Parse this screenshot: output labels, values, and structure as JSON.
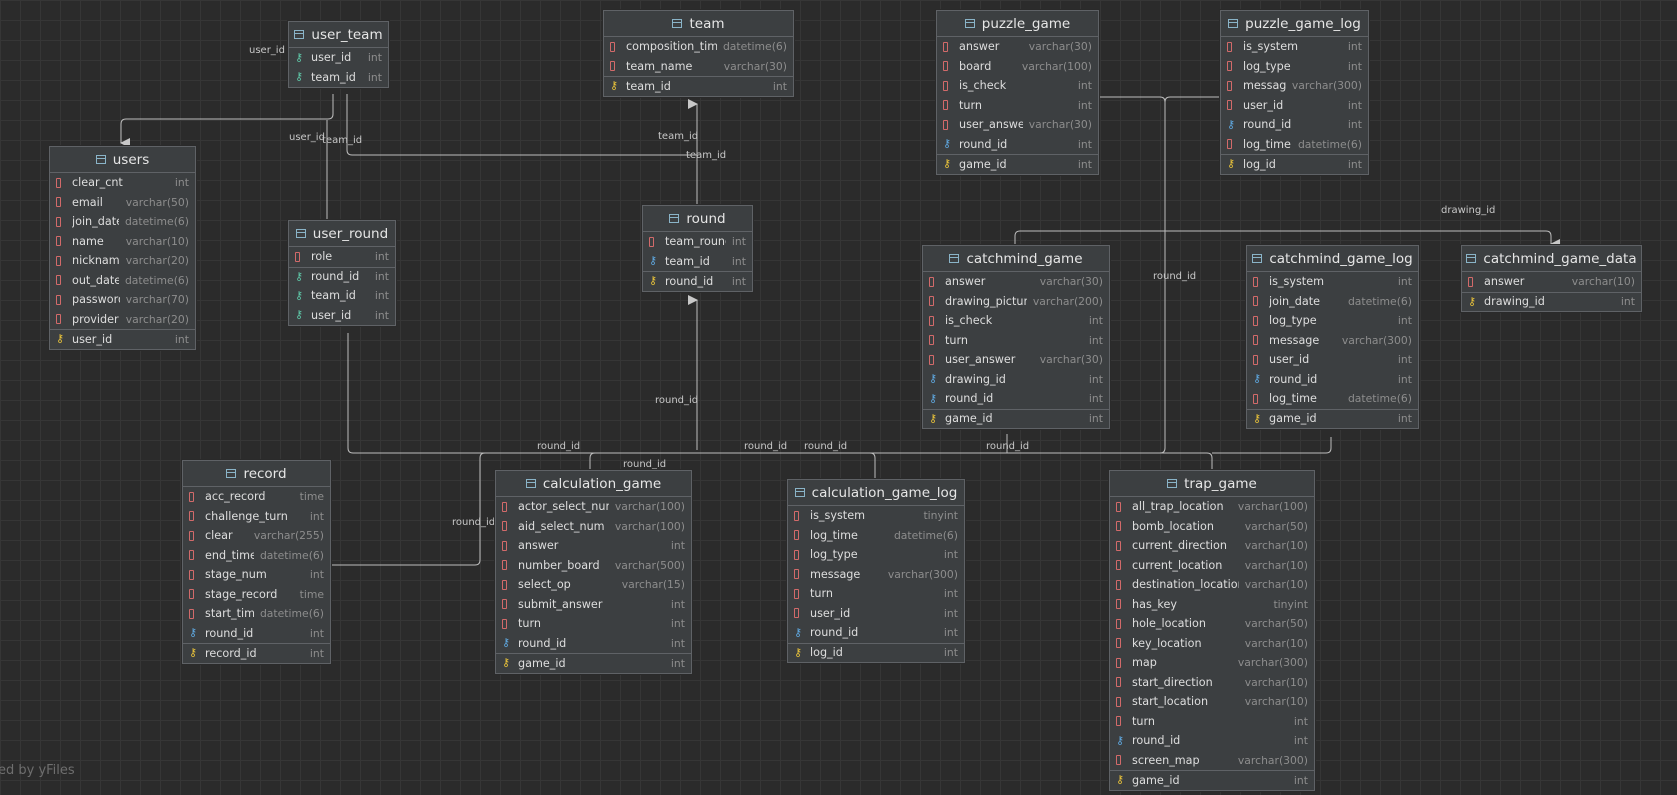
{
  "watermark": "ed by yFiles",
  "colors": {
    "background": "#2b2b2b",
    "table": "#3c3f41",
    "column_icon": "#d26a6a",
    "primary_key": "#e8c23a",
    "foreign_key": "#5fa8e0"
  },
  "tables": [
    {
      "name": "user_team",
      "columns": [
        {
          "name": "user_id",
          "type": "int",
          "icon": "pk-fk-key-icon"
        },
        {
          "name": "team_id",
          "type": "int",
          "icon": "pk-fk-key-icon"
        }
      ],
      "keys": []
    },
    {
      "name": "team",
      "columns": [
        {
          "name": "composition_time",
          "type": "datetime(6)",
          "icon": "column-icon"
        },
        {
          "name": "team_name",
          "type": "varchar(30)",
          "icon": "column-icon"
        }
      ],
      "keys": [
        {
          "name": "team_id",
          "type": "int",
          "icon": "primary-key-icon"
        }
      ]
    },
    {
      "name": "puzzle_game",
      "columns": [
        {
          "name": "answer",
          "type": "varchar(30)",
          "icon": "column-icon"
        },
        {
          "name": "board",
          "type": "varchar(100)",
          "icon": "column-icon"
        },
        {
          "name": "is_check",
          "type": "int",
          "icon": "column-icon"
        },
        {
          "name": "turn",
          "type": "int",
          "icon": "column-icon"
        },
        {
          "name": "user_answer",
          "type": "varchar(30)",
          "icon": "column-icon"
        },
        {
          "name": "round_id",
          "type": "int",
          "icon": "foreign-key-icon"
        }
      ],
      "keys": [
        {
          "name": "game_id",
          "type": "int",
          "icon": "primary-key-icon"
        }
      ]
    },
    {
      "name": "puzzle_game_log",
      "columns": [
        {
          "name": "is_system",
          "type": "int",
          "icon": "column-icon"
        },
        {
          "name": "log_type",
          "type": "int",
          "icon": "column-icon"
        },
        {
          "name": "message",
          "type": "varchar(300)",
          "icon": "column-icon"
        },
        {
          "name": "user_id",
          "type": "int",
          "icon": "column-icon"
        },
        {
          "name": "round_id",
          "type": "int",
          "icon": "foreign-key-icon"
        },
        {
          "name": "log_time",
          "type": "datetime(6)",
          "icon": "column-icon"
        }
      ],
      "keys": [
        {
          "name": "log_id",
          "type": "int",
          "icon": "primary-key-icon"
        }
      ]
    },
    {
      "name": "users",
      "columns": [
        {
          "name": "clear_cnt",
          "type": "int",
          "icon": "column-icon"
        },
        {
          "name": "email",
          "type": "varchar(50)",
          "icon": "column-icon"
        },
        {
          "name": "join_date",
          "type": "datetime(6)",
          "icon": "column-icon"
        },
        {
          "name": "name",
          "type": "varchar(10)",
          "icon": "column-icon"
        },
        {
          "name": "nickname",
          "type": "varchar(20)",
          "icon": "column-icon"
        },
        {
          "name": "out_date",
          "type": "datetime(6)",
          "icon": "column-icon"
        },
        {
          "name": "password",
          "type": "varchar(70)",
          "icon": "column-icon"
        },
        {
          "name": "provider",
          "type": "varchar(20)",
          "icon": "column-icon"
        }
      ],
      "keys": [
        {
          "name": "user_id",
          "type": "int",
          "icon": "primary-key-icon"
        }
      ]
    },
    {
      "name": "user_round",
      "columns": [
        {
          "name": "role",
          "type": "int",
          "icon": "column-icon"
        }
      ],
      "keys": [
        {
          "name": "round_id",
          "type": "int",
          "icon": "pk-fk-key-icon"
        },
        {
          "name": "team_id",
          "type": "int",
          "icon": "pk-fk-key-icon"
        },
        {
          "name": "user_id",
          "type": "int",
          "icon": "pk-fk-key-icon"
        }
      ]
    },
    {
      "name": "round",
      "columns": [
        {
          "name": "team_round",
          "type": "int",
          "icon": "column-icon"
        },
        {
          "name": "team_id",
          "type": "int",
          "icon": "foreign-key-icon"
        }
      ],
      "keys": [
        {
          "name": "round_id",
          "type": "int",
          "icon": "primary-key-icon"
        }
      ]
    },
    {
      "name": "catchmind_game",
      "columns": [
        {
          "name": "answer",
          "type": "varchar(30)",
          "icon": "column-icon"
        },
        {
          "name": "drawing_picture",
          "type": "varchar(200)",
          "icon": "column-icon"
        },
        {
          "name": "is_check",
          "type": "int",
          "icon": "column-icon"
        },
        {
          "name": "turn",
          "type": "int",
          "icon": "column-icon"
        },
        {
          "name": "user_answer",
          "type": "varchar(30)",
          "icon": "column-icon"
        },
        {
          "name": "drawing_id",
          "type": "int",
          "icon": "foreign-key-icon"
        },
        {
          "name": "round_id",
          "type": "int",
          "icon": "foreign-key-icon"
        }
      ],
      "keys": [
        {
          "name": "game_id",
          "type": "int",
          "icon": "primary-key-icon"
        }
      ]
    },
    {
      "name": "catchmind_game_log",
      "columns": [
        {
          "name": "is_system",
          "type": "int",
          "icon": "column-icon"
        },
        {
          "name": "join_date",
          "type": "datetime(6)",
          "icon": "column-icon"
        },
        {
          "name": "log_type",
          "type": "int",
          "icon": "column-icon"
        },
        {
          "name": "message",
          "type": "varchar(300)",
          "icon": "column-icon"
        },
        {
          "name": "user_id",
          "type": "int",
          "icon": "column-icon"
        },
        {
          "name": "round_id",
          "type": "int",
          "icon": "foreign-key-icon"
        },
        {
          "name": "log_time",
          "type": "datetime(6)",
          "icon": "column-icon"
        }
      ],
      "keys": [
        {
          "name": "game_id",
          "type": "int",
          "icon": "primary-key-icon"
        }
      ]
    },
    {
      "name": "catchmind_game_data",
      "columns": [
        {
          "name": "answer",
          "type": "varchar(10)",
          "icon": "column-icon"
        }
      ],
      "keys": [
        {
          "name": "drawing_id",
          "type": "int",
          "icon": "primary-key-icon"
        }
      ]
    },
    {
      "name": "record",
      "columns": [
        {
          "name": "acc_record",
          "type": "time",
          "icon": "column-icon"
        },
        {
          "name": "challenge_turn",
          "type": "int",
          "icon": "column-icon"
        },
        {
          "name": "clear",
          "type": "varchar(255)",
          "icon": "column-icon"
        },
        {
          "name": "end_time",
          "type": "datetime(6)",
          "icon": "column-icon"
        },
        {
          "name": "stage_num",
          "type": "int",
          "icon": "column-icon"
        },
        {
          "name": "stage_record",
          "type": "time",
          "icon": "column-icon"
        },
        {
          "name": "start_time",
          "type": "datetime(6)",
          "icon": "column-icon"
        },
        {
          "name": "round_id",
          "type": "int",
          "icon": "foreign-key-icon"
        }
      ],
      "keys": [
        {
          "name": "record_id",
          "type": "int",
          "icon": "primary-key-icon"
        }
      ]
    },
    {
      "name": "calculation_game",
      "columns": [
        {
          "name": "actor_select_num",
          "type": "varchar(100)",
          "icon": "column-icon"
        },
        {
          "name": "aid_select_num",
          "type": "varchar(100)",
          "icon": "column-icon"
        },
        {
          "name": "answer",
          "type": "int",
          "icon": "column-icon"
        },
        {
          "name": "number_board",
          "type": "varchar(500)",
          "icon": "column-icon"
        },
        {
          "name": "select_op",
          "type": "varchar(15)",
          "icon": "column-icon"
        },
        {
          "name": "submit_answer",
          "type": "int",
          "icon": "column-icon"
        },
        {
          "name": "turn",
          "type": "int",
          "icon": "column-icon"
        },
        {
          "name": "round_id",
          "type": "int",
          "icon": "foreign-key-icon"
        }
      ],
      "keys": [
        {
          "name": "game_id",
          "type": "int",
          "icon": "primary-key-icon"
        }
      ]
    },
    {
      "name": "calculation_game_log",
      "columns": [
        {
          "name": "is_system",
          "type": "tinyint",
          "icon": "column-icon"
        },
        {
          "name": "log_time",
          "type": "datetime(6)",
          "icon": "column-icon"
        },
        {
          "name": "log_type",
          "type": "int",
          "icon": "column-icon"
        },
        {
          "name": "message",
          "type": "varchar(300)",
          "icon": "column-icon"
        },
        {
          "name": "turn",
          "type": "int",
          "icon": "column-icon"
        },
        {
          "name": "user_id",
          "type": "int",
          "icon": "column-icon"
        },
        {
          "name": "round_id",
          "type": "int",
          "icon": "foreign-key-icon"
        }
      ],
      "keys": [
        {
          "name": "log_id",
          "type": "int",
          "icon": "primary-key-icon"
        }
      ]
    },
    {
      "name": "trap_game",
      "columns": [
        {
          "name": "all_trap_location",
          "type": "varchar(100)",
          "icon": "column-icon"
        },
        {
          "name": "bomb_location",
          "type": "varchar(50)",
          "icon": "column-icon"
        },
        {
          "name": "current_direction",
          "type": "varchar(10)",
          "icon": "column-icon"
        },
        {
          "name": "current_location",
          "type": "varchar(10)",
          "icon": "column-icon"
        },
        {
          "name": "destination_location",
          "type": "varchar(10)",
          "icon": "column-icon"
        },
        {
          "name": "has_key",
          "type": "tinyint",
          "icon": "column-icon"
        },
        {
          "name": "hole_location",
          "type": "varchar(50)",
          "icon": "column-icon"
        },
        {
          "name": "key_location",
          "type": "varchar(10)",
          "icon": "column-icon"
        },
        {
          "name": "map",
          "type": "varchar(300)",
          "icon": "column-icon"
        },
        {
          "name": "start_direction",
          "type": "varchar(10)",
          "icon": "column-icon"
        },
        {
          "name": "start_location",
          "type": "varchar(10)",
          "icon": "column-icon"
        },
        {
          "name": "turn",
          "type": "int",
          "icon": "column-icon"
        },
        {
          "name": "round_id",
          "type": "int",
          "icon": "foreign-key-icon"
        },
        {
          "name": "screen_map",
          "type": "varchar(300)",
          "icon": "column-icon"
        }
      ],
      "keys": [
        {
          "name": "game_id",
          "type": "int",
          "icon": "primary-key-icon"
        }
      ]
    }
  ],
  "edge_labels": [
    "user_id",
    "user_id",
    "team_id",
    "team_id",
    "team_id",
    "drawing_id",
    "round_id",
    "round_id",
    "round_id",
    "round_id",
    "round_id",
    "round_id",
    "round_id",
    "round_id"
  ]
}
